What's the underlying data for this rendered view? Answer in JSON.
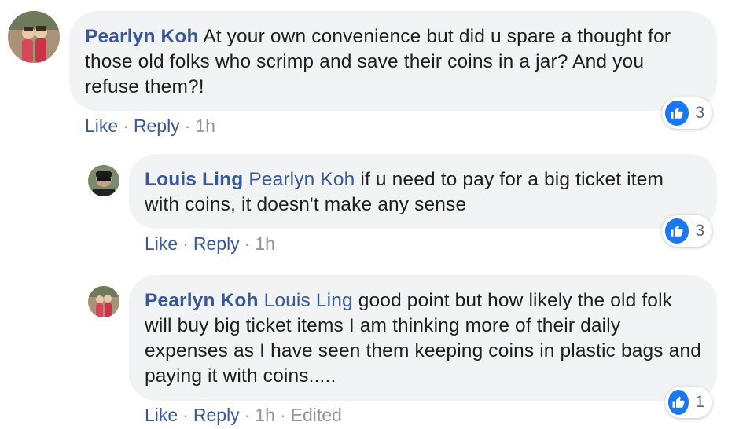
{
  "comments": [
    {
      "author": "Pearlyn Koh",
      "mention": "",
      "text": "At your own convenience but did u spare a thought for those old folks who scrimp and save their coins in a jar? And you refuse them?!",
      "like_label": "Like",
      "reply_label": "Reply",
      "time": "1h",
      "edited": "",
      "reaction_count": "3",
      "reaction_icon": "like-thumb-icon"
    },
    {
      "author": "Louis Ling",
      "mention": "Pearlyn Koh",
      "text": "if u need to pay for a big ticket item with coins, it doesn't make any sense",
      "like_label": "Like",
      "reply_label": "Reply",
      "time": "1h",
      "edited": "",
      "reaction_count": "3",
      "reaction_icon": "like-thumb-icon"
    },
    {
      "author": "Pearlyn Koh",
      "mention": "Louis Ling",
      "text": "good point but how likely the old folk will buy big ticket items I am thinking more of their daily expenses as I have seen them keeping coins in plastic bags and paying it with coins.....",
      "like_label": "Like",
      "reply_label": "Reply",
      "time": "1h",
      "edited": "Edited",
      "reaction_count": "1",
      "reaction_icon": "like-thumb-icon"
    }
  ],
  "separator": "·",
  "colors": {
    "link": "#385898",
    "bubble": "#f2f3f5",
    "like_blue": "#1877f2",
    "meta": "#90949c"
  }
}
